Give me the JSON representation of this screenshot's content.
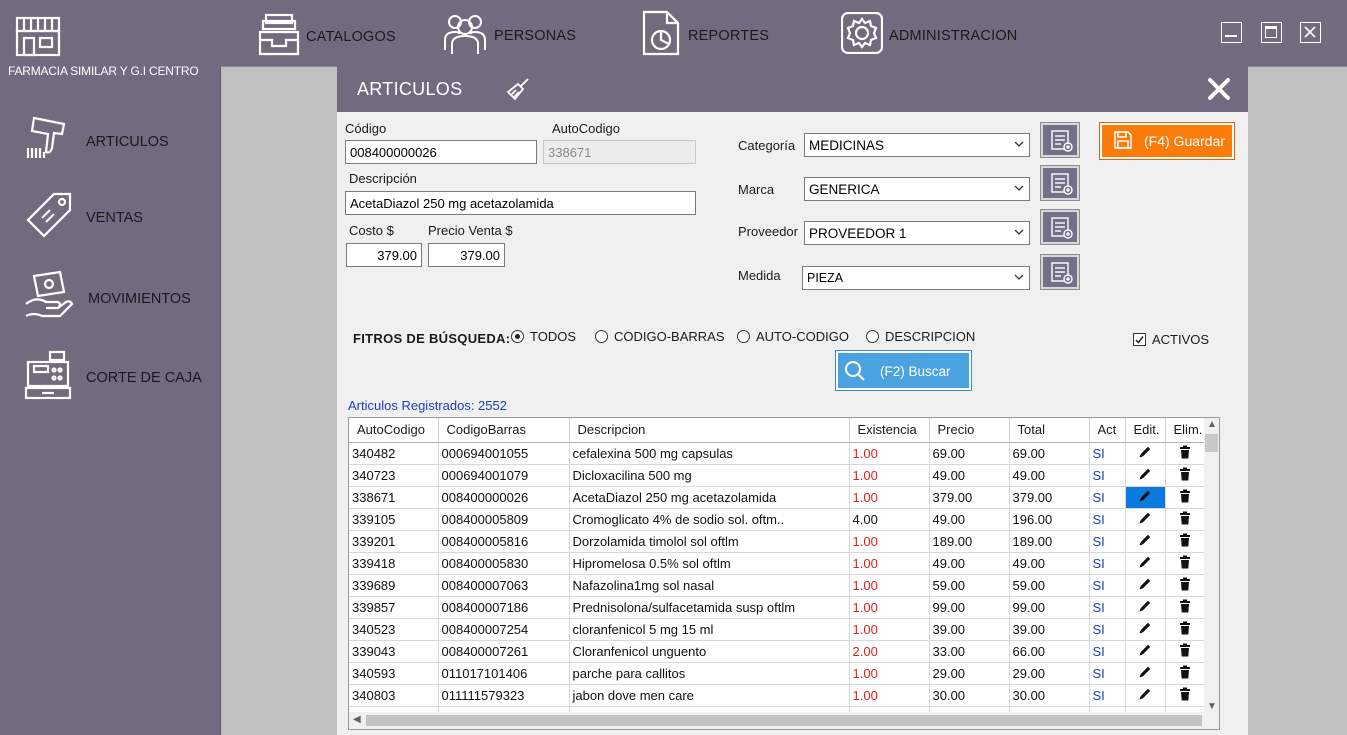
{
  "app": {
    "brand": "FARMACIA SIMILAR Y G.I CENTRO"
  },
  "top_nav": [
    {
      "label": "CATALOGOS",
      "icon": "inbox-tray-icon"
    },
    {
      "label": "PERSONAS",
      "icon": "people-group-icon"
    },
    {
      "label": "REPORTES",
      "icon": "report-chart-icon"
    },
    {
      "label": "ADMINISTRACION",
      "icon": "gear-icon"
    }
  ],
  "window_controls": [
    "minimize-icon",
    "maximize-icon",
    "close-icon"
  ],
  "sidebar": [
    {
      "label": "ARTICULOS",
      "icon": "barcode-scanner-icon"
    },
    {
      "label": "VENTAS",
      "icon": "price-tag-icon"
    },
    {
      "label": "MOVIMIENTOS",
      "icon": "hand-money-icon"
    },
    {
      "label": "CORTE DE CAJA",
      "icon": "cash-register-icon"
    }
  ],
  "panel": {
    "title": "ARTICULOS",
    "fields": {
      "codigo_label": "Código",
      "codigo_value": "008400000026",
      "autocodigo_label": "AutoCodigo",
      "autocodigo_value": "338671",
      "descripcion_label": "Descripción",
      "descripcion_value": "AcetaDiazol 250 mg acetazolamida",
      "costo_label": "Costo $",
      "costo_value": "379.00",
      "precio_label": "Precio Venta $",
      "precio_value": "379.00"
    },
    "combos": {
      "categoria_label": "Categoría",
      "categoria_value": "MEDICINAS",
      "marca_label": "Marca",
      "marca_value": "GENERICA",
      "proveedor_label": "Proveedor",
      "proveedor_value": "PROVEEDOR 1",
      "medida_label": "Medida",
      "medida_value": "PIEZA"
    },
    "save_label": "(F4) Guardar",
    "filters": {
      "title": "FITROS DE BÚSQUEDA:",
      "options": [
        "TODOS",
        "CODIGO-BARRAS",
        "AUTO-CODIGO",
        "DESCRIPCION"
      ],
      "selected": "TODOS",
      "activos_label": "ACTIVOS",
      "activos_checked": true
    },
    "search_label": "(F2) Buscar",
    "count_text": "Articulos Registrados: 2552",
    "grid": {
      "columns": [
        "AutoCodigo",
        "CodigoBarras",
        "Descripcion",
        "Existencia",
        "Precio",
        "Total",
        "Act",
        "Edit.",
        "Elim."
      ],
      "rows": [
        [
          "340482",
          "000694001055",
          "cefalexina 500 mg capsulas",
          "1.00",
          "69.00",
          "69.00",
          "SI"
        ],
        [
          "340723",
          "000694001079",
          "Dicloxacilina 500 mg",
          "1.00",
          "49.00",
          "49.00",
          "SI"
        ],
        [
          "338671",
          "008400000026",
          "AcetaDiazol 250 mg acetazolamida",
          "1.00",
          "379.00",
          "379.00",
          "SI"
        ],
        [
          "339105",
          "008400005809",
          "Cromoglicato 4% de sodio sol. oftm..",
          "4.00",
          "49.00",
          "196.00",
          "SI"
        ],
        [
          "339201",
          "008400005816",
          "Dorzolamida timolol sol oftlm",
          "1.00",
          "189.00",
          "189.00",
          "SI"
        ],
        [
          "339418",
          "008400005830",
          "Hipromelosa 0.5% sol oftlm",
          "1.00",
          "49.00",
          "49.00",
          "SI"
        ],
        [
          "339689",
          "008400007063",
          "Nafazolina1mg sol nasal",
          "1.00",
          "59.00",
          "59.00",
          "SI"
        ],
        [
          "339857",
          "008400007186",
          "Prednisolona/sulfacetamida susp oftlm",
          "1.00",
          "99.00",
          "99.00",
          "SI"
        ],
        [
          "340523",
          "008400007254",
          "cloranfenicol 5 mg 15 ml",
          "1.00",
          "39.00",
          "39.00",
          "SI"
        ],
        [
          "339043",
          "008400007261",
          "Cloranfenicol unguento",
          "2.00",
          "33.00",
          "66.00",
          "SI"
        ],
        [
          "340593",
          "011017101406",
          "parche para callitos",
          "1.00",
          "29.00",
          "29.00",
          "SI"
        ],
        [
          "340803",
          "011111579323",
          "jabon dove men care",
          "1.00",
          "30.00",
          "30.00",
          "SI"
        ]
      ],
      "red_existencia_rows": [
        0,
        1,
        2,
        4,
        5,
        6,
        7,
        8,
        9,
        10,
        11
      ],
      "selected_edit_row": 2
    }
  },
  "colors": {
    "chrome": "#726b80",
    "save": "#fb7b0b",
    "search": "#4aa3e0",
    "link_blue": "#1b3fb5",
    "red": "#e0201a",
    "selection": "#0a7ae0"
  }
}
